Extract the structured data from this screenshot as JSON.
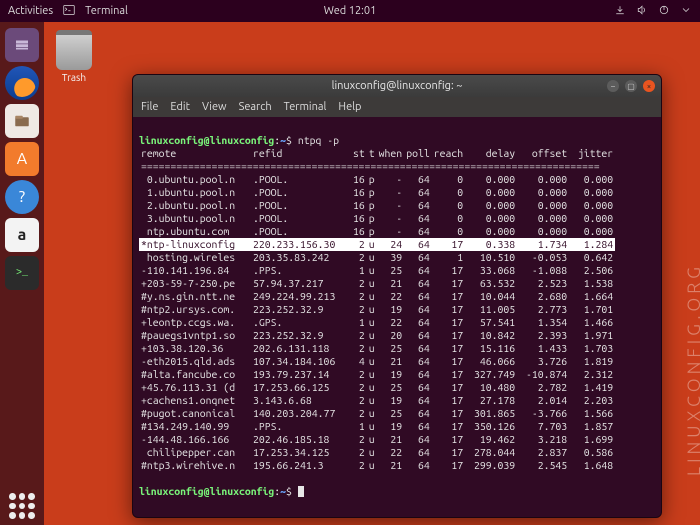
{
  "topbar": {
    "activities": "Activities",
    "app_label": "Terminal",
    "clock": "Wed 12:01"
  },
  "desktop": {
    "trash_label": "Trash"
  },
  "window": {
    "title": "linuxconfig@linuxconfig: ~",
    "menu": [
      "File",
      "Edit",
      "View",
      "Search",
      "Terminal",
      "Help"
    ]
  },
  "prompt": {
    "user_host": "linuxconfig@linuxconfig",
    "colon": ":",
    "path": "~",
    "dollar": "$",
    "command": "ntpq -p"
  },
  "headers": [
    "remote",
    "refid",
    "st",
    "t",
    "when",
    "poll",
    "reach",
    "delay",
    "offset",
    "jitter"
  ],
  "rows": [
    {
      "remote": " 0.ubuntu.pool.n",
      "refid": ".POOL.",
      "st": "16",
      "t": "p",
      "when": "-",
      "poll": "64",
      "reach": "0",
      "delay": "0.000",
      "offset": "0.000",
      "jitter": "0.000",
      "hl": false
    },
    {
      "remote": " 1.ubuntu.pool.n",
      "refid": ".POOL.",
      "st": "16",
      "t": "p",
      "when": "-",
      "poll": "64",
      "reach": "0",
      "delay": "0.000",
      "offset": "0.000",
      "jitter": "0.000",
      "hl": false
    },
    {
      "remote": " 2.ubuntu.pool.n",
      "refid": ".POOL.",
      "st": "16",
      "t": "p",
      "when": "-",
      "poll": "64",
      "reach": "0",
      "delay": "0.000",
      "offset": "0.000",
      "jitter": "0.000",
      "hl": false
    },
    {
      "remote": " 3.ubuntu.pool.n",
      "refid": ".POOL.",
      "st": "16",
      "t": "p",
      "when": "-",
      "poll": "64",
      "reach": "0",
      "delay": "0.000",
      "offset": "0.000",
      "jitter": "0.000",
      "hl": false
    },
    {
      "remote": " ntp.ubuntu.com ",
      "refid": ".POOL.",
      "st": "16",
      "t": "p",
      "when": "-",
      "poll": "64",
      "reach": "0",
      "delay": "0.000",
      "offset": "0.000",
      "jitter": "0.000",
      "hl": false
    },
    {
      "remote": "*ntp-linuxconfig",
      "refid": "220.233.156.30",
      "st": "2",
      "t": "u",
      "when": "24",
      "poll": "64",
      "reach": "17",
      "delay": "0.338",
      "offset": "1.734",
      "jitter": "1.284",
      "hl": true
    },
    {
      "remote": " hosting.wireles",
      "refid": "203.35.83.242",
      "st": "2",
      "t": "u",
      "when": "39",
      "poll": "64",
      "reach": "1",
      "delay": "10.510",
      "offset": "-0.053",
      "jitter": "0.642",
      "hl": false
    },
    {
      "remote": "-110.141.196.84 ",
      "refid": ".PPS.",
      "st": "1",
      "t": "u",
      "when": "25",
      "poll": "64",
      "reach": "17",
      "delay": "33.068",
      "offset": "-1.088",
      "jitter": "2.506",
      "hl": false
    },
    {
      "remote": "+203-59-7-250.pe",
      "refid": "57.94.37.217",
      "st": "2",
      "t": "u",
      "when": "21",
      "poll": "64",
      "reach": "17",
      "delay": "63.532",
      "offset": "2.523",
      "jitter": "1.538",
      "hl": false
    },
    {
      "remote": "#y.ns.gin.ntt.ne",
      "refid": "249.224.99.213",
      "st": "2",
      "t": "u",
      "when": "22",
      "poll": "64",
      "reach": "17",
      "delay": "10.044",
      "offset": "2.680",
      "jitter": "1.664",
      "hl": false
    },
    {
      "remote": "#ntp2.ursys.com.",
      "refid": "223.252.32.9",
      "st": "2",
      "t": "u",
      "when": "19",
      "poll": "64",
      "reach": "17",
      "delay": "11.005",
      "offset": "2.773",
      "jitter": "1.701",
      "hl": false
    },
    {
      "remote": "+leontp.ccgs.wa.",
      "refid": ".GPS.",
      "st": "1",
      "t": "u",
      "when": "22",
      "poll": "64",
      "reach": "17",
      "delay": "57.541",
      "offset": "1.354",
      "jitter": "1.466",
      "hl": false
    },
    {
      "remote": "#pauegs1vntp1.so",
      "refid": "223.252.32.9",
      "st": "2",
      "t": "u",
      "when": "20",
      "poll": "64",
      "reach": "17",
      "delay": "10.842",
      "offset": "2.393",
      "jitter": "1.971",
      "hl": false
    },
    {
      "remote": "+103.38.120.36  ",
      "refid": "202.6.131.118",
      "st": "2",
      "t": "u",
      "when": "25",
      "poll": "64",
      "reach": "17",
      "delay": "15.116",
      "offset": "1.433",
      "jitter": "1.703",
      "hl": false
    },
    {
      "remote": "-eth2015.qld.ads",
      "refid": "107.34.184.106",
      "st": "4",
      "t": "u",
      "when": "21",
      "poll": "64",
      "reach": "17",
      "delay": "46.066",
      "offset": "3.726",
      "jitter": "1.819",
      "hl": false
    },
    {
      "remote": "#alta.fancube.co",
      "refid": "193.79.237.14",
      "st": "2",
      "t": "u",
      "when": "19",
      "poll": "64",
      "reach": "17",
      "delay": "327.749",
      "offset": "-10.874",
      "jitter": "2.312",
      "hl": false
    },
    {
      "remote": "+45.76.113.31 (d",
      "refid": "17.253.66.125",
      "st": "2",
      "t": "u",
      "when": "25",
      "poll": "64",
      "reach": "17",
      "delay": "10.480",
      "offset": "2.782",
      "jitter": "1.419",
      "hl": false
    },
    {
      "remote": "+cachens1.onqnet",
      "refid": "3.143.6.68",
      "st": "2",
      "t": "u",
      "when": "19",
      "poll": "64",
      "reach": "17",
      "delay": "27.178",
      "offset": "2.014",
      "jitter": "2.203",
      "hl": false
    },
    {
      "remote": "#pugot.canonical",
      "refid": "140.203.204.77",
      "st": "2",
      "t": "u",
      "when": "25",
      "poll": "64",
      "reach": "17",
      "delay": "301.865",
      "offset": "-3.766",
      "jitter": "1.566",
      "hl": false
    },
    {
      "remote": "#134.249.140.99 ",
      "refid": ".PPS.",
      "st": "1",
      "t": "u",
      "when": "19",
      "poll": "64",
      "reach": "17",
      "delay": "350.126",
      "offset": "7.703",
      "jitter": "1.857",
      "hl": false
    },
    {
      "remote": "-144.48.166.166 ",
      "refid": "202.46.185.18",
      "st": "2",
      "t": "u",
      "when": "21",
      "poll": "64",
      "reach": "17",
      "delay": "19.462",
      "offset": "3.218",
      "jitter": "1.699",
      "hl": false
    },
    {
      "remote": " chilipepper.can",
      "refid": "17.253.34.125",
      "st": "2",
      "t": "u",
      "when": "22",
      "poll": "64",
      "reach": "17",
      "delay": "278.044",
      "offset": "2.837",
      "jitter": "0.586",
      "hl": false
    },
    {
      "remote": "#ntp3.wirehive.n",
      "refid": "195.66.241.3",
      "st": "2",
      "t": "u",
      "when": "21",
      "poll": "64",
      "reach": "17",
      "delay": "299.039",
      "offset": "2.545",
      "jitter": "1.648",
      "hl": false
    }
  ],
  "watermark": "LINUXCONFIG.ORG"
}
